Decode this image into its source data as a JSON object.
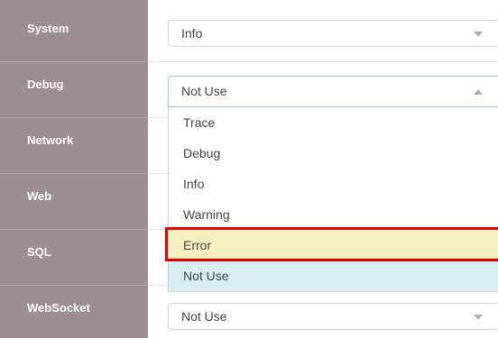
{
  "rows": [
    {
      "label": "System",
      "value": "Info"
    },
    {
      "label": "Debug",
      "value": "Not Use"
    },
    {
      "label": "Network",
      "value": ""
    },
    {
      "label": "Web",
      "value": ""
    },
    {
      "label": "SQL",
      "value": ""
    },
    {
      "label": "WebSocket",
      "value": "Not Use"
    }
  ],
  "dropdown": {
    "options": [
      "Trace",
      "Debug",
      "Info",
      "Warning",
      "Error",
      "Not Use"
    ],
    "highlighted": "Error",
    "selected": "Not Use"
  },
  "colors": {
    "label_column": "#9b8d92",
    "option_highlight": "#f7f1c2",
    "option_selected": "#d7eef3",
    "annotation_box": "#e00000"
  },
  "icons": {
    "closed_select": "chevron-down-icon",
    "open_select": "chevron-up-icon"
  }
}
